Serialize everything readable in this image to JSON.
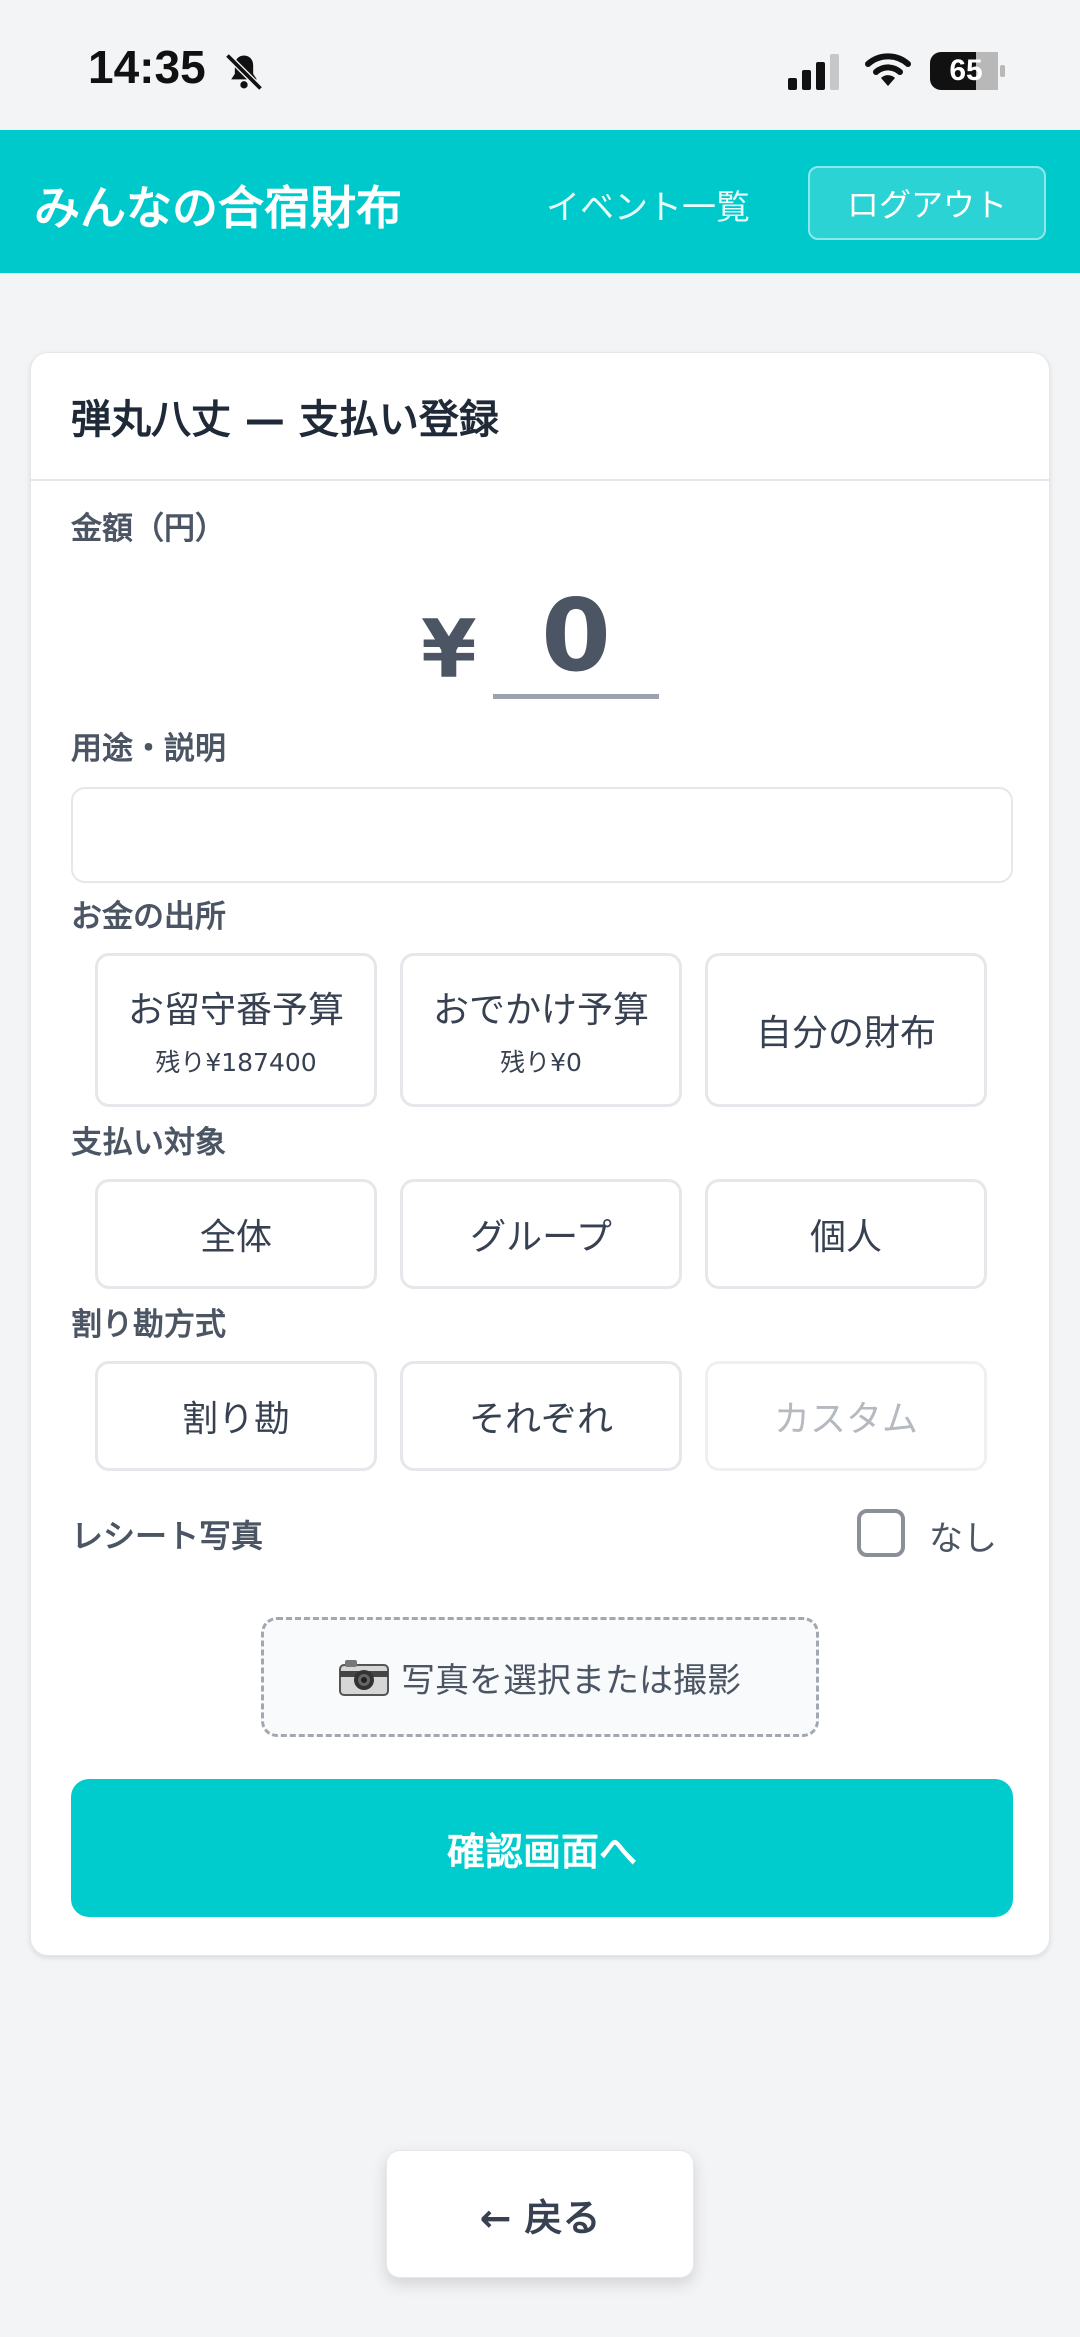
{
  "status_bar": {
    "time": "14:35",
    "battery": "65",
    "icons": [
      "bell-muted-icon",
      "signal-icon",
      "wifi-icon",
      "battery-icon"
    ]
  },
  "header": {
    "title": "みんなの合宿財布",
    "nav_events": "イベント一覧",
    "logout": "ログアウト",
    "accent_color": "#00c9cc"
  },
  "form": {
    "title": "弾丸八丈 — 支払い登録",
    "amount_label": "金額（円）",
    "currency_symbol": "¥",
    "amount_value": "0",
    "purpose_label": "用途・説明",
    "purpose_value": "",
    "source_label": "お金の出所",
    "sources": [
      {
        "label": "お留守番予算",
        "sub": "残り¥187400"
      },
      {
        "label": "おでかけ予算",
        "sub": "残り¥0"
      },
      {
        "label": "自分の財布",
        "sub": ""
      }
    ],
    "target_label": "支払い対象",
    "targets": [
      "全体",
      "グループ",
      "個人"
    ],
    "split_label": "割り勘方式",
    "splits": [
      {
        "label": "割り勘",
        "disabled": false
      },
      {
        "label": "それぞれ",
        "disabled": false
      },
      {
        "label": "カスタム",
        "disabled": true
      }
    ],
    "receipt_label": "レシート写真",
    "receipt_none_label": "なし",
    "photo_button": "写真を選択または撮影",
    "confirm_button": "確認画面へ"
  },
  "footer": {
    "back_button": "← 戻る"
  }
}
